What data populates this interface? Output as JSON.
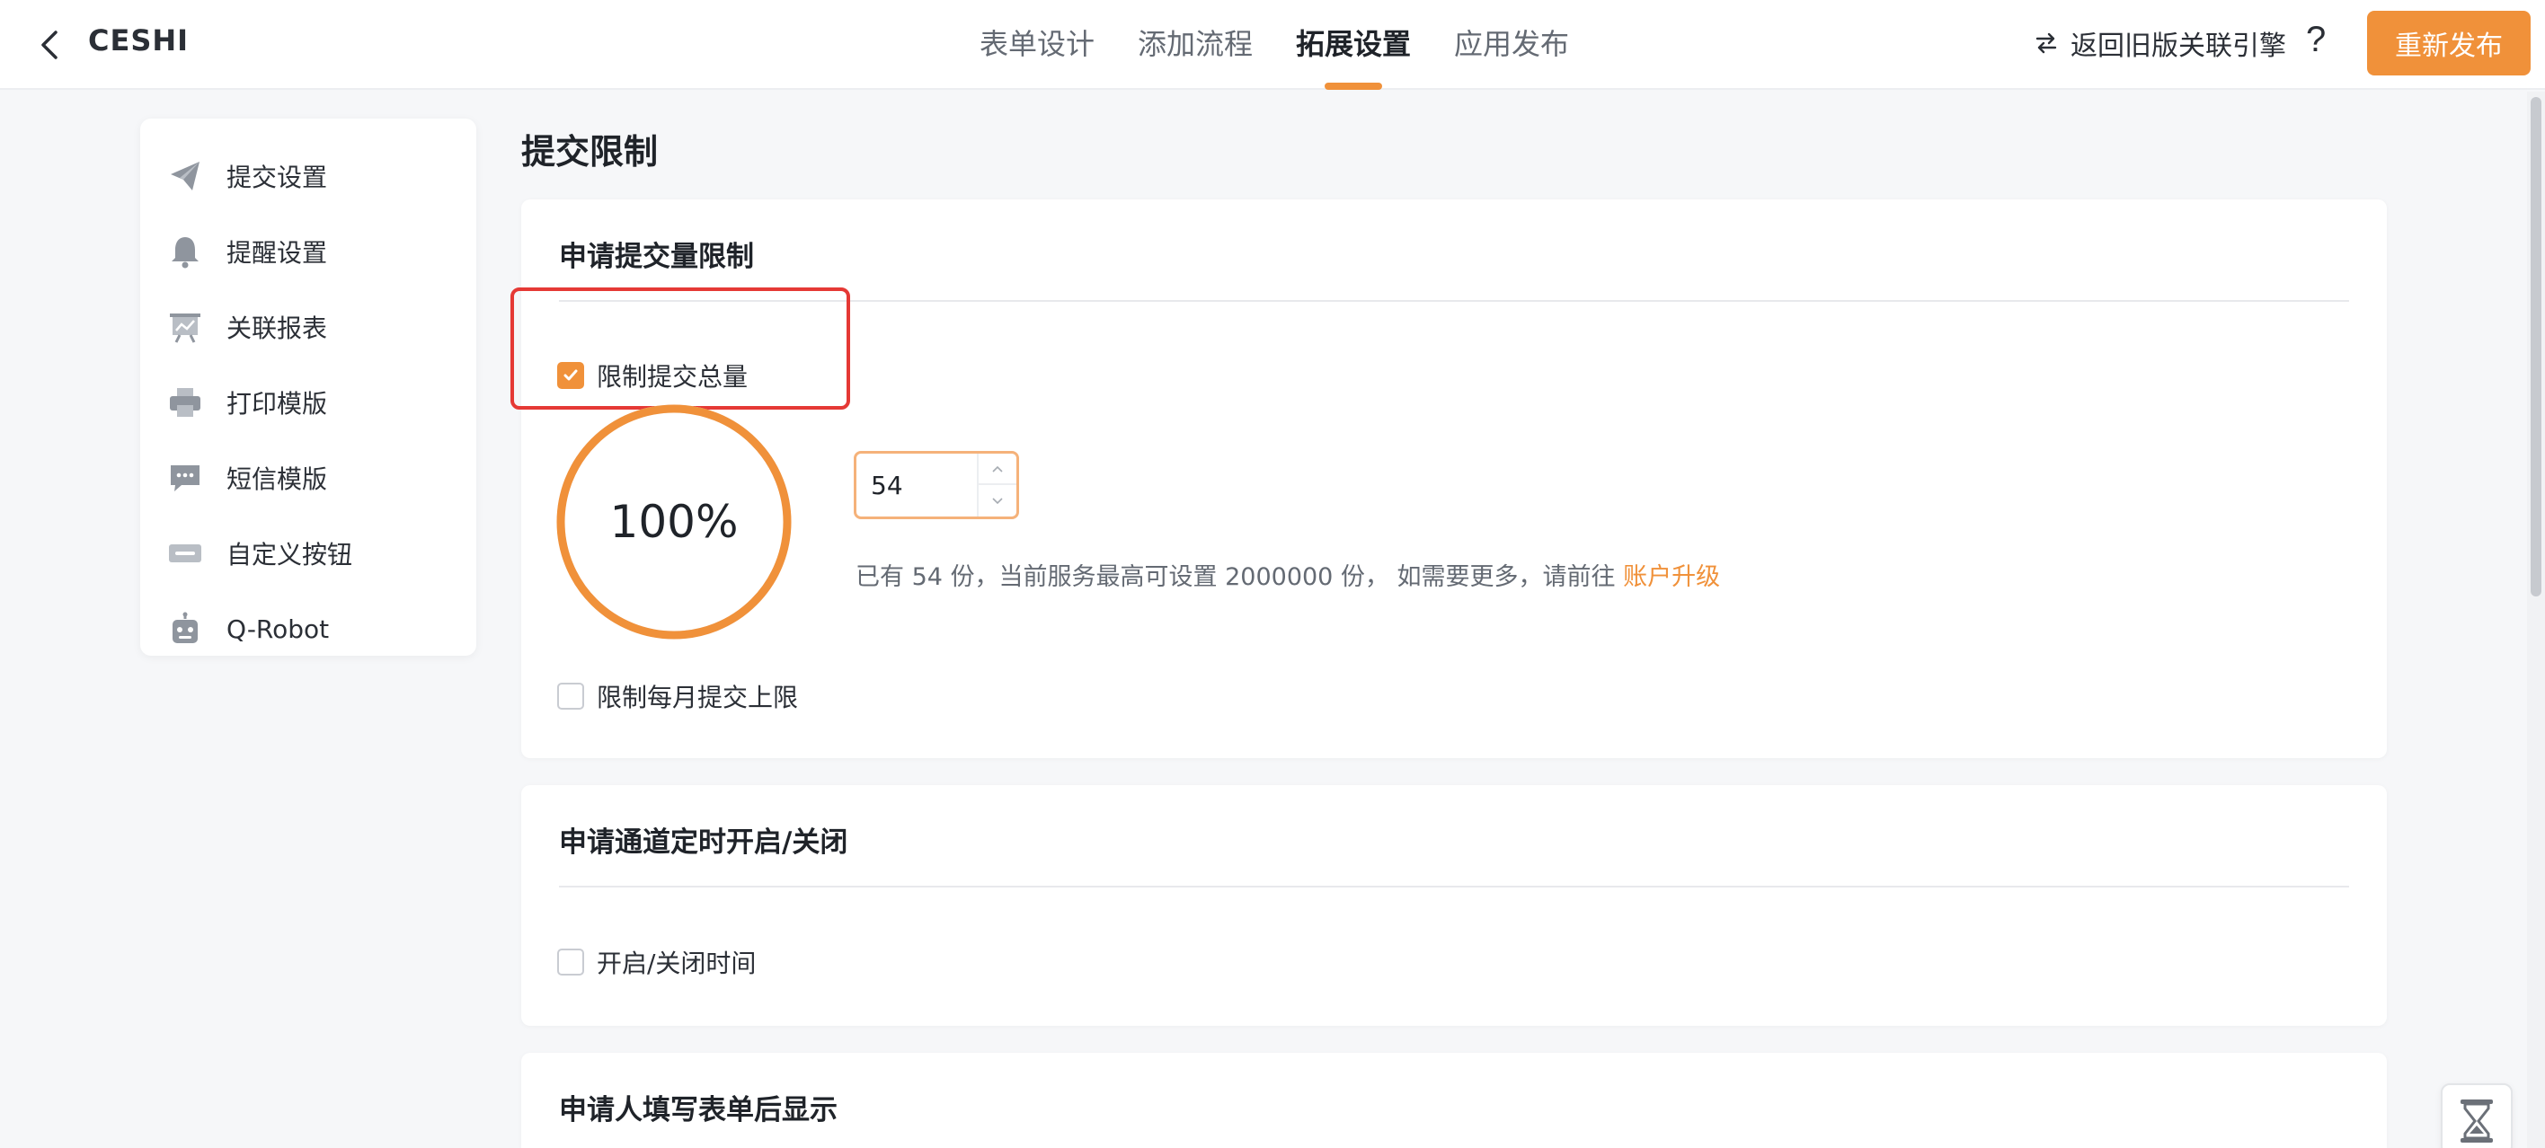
{
  "header": {
    "title": "CESHI",
    "tabs": [
      {
        "label": "表单设计",
        "active": false
      },
      {
        "label": "添加流程",
        "active": false
      },
      {
        "label": "拓展设置",
        "active": true
      },
      {
        "label": "应用发布",
        "active": false
      }
    ],
    "legacy_link": "返回旧版关联引擎",
    "help": "?",
    "publish_label": "重新发布"
  },
  "sidebar": {
    "items": [
      {
        "label": "提交设置",
        "icon": "paper-plane-icon"
      },
      {
        "label": "提醒设置",
        "icon": "bell-icon"
      },
      {
        "label": "关联报表",
        "icon": "chart-board-icon"
      },
      {
        "label": "打印模版",
        "icon": "printer-icon"
      },
      {
        "label": "短信模版",
        "icon": "message-icon"
      },
      {
        "label": "自定义按钮",
        "icon": "btn-icon"
      },
      {
        "label": "Q-Robot",
        "icon": "robot-icon"
      }
    ]
  },
  "main": {
    "page_title": "提交限制",
    "submit_limit": {
      "title": "申请提交量限制",
      "total_limit_label": "限制提交总量",
      "total_limit_checked": true,
      "progress_percent": 100,
      "progress_text": "100%",
      "limit_value": "54",
      "hint_prefix": "已有 54 份，当前服务最高可设置 2000000 份， 如需要更多，请前往 ",
      "upgrade_link": "账户升级",
      "monthly_limit_label": "限制每月提交上限",
      "monthly_limit_checked": false
    },
    "schedule": {
      "title": "申请通道定时开启/关闭",
      "time_label": "开启/关闭时间",
      "time_checked": false
    },
    "after_submit": {
      "title": "申请人填写表单后显示"
    }
  },
  "colors": {
    "accent": "#f0913a",
    "highlight": "#e53935"
  }
}
